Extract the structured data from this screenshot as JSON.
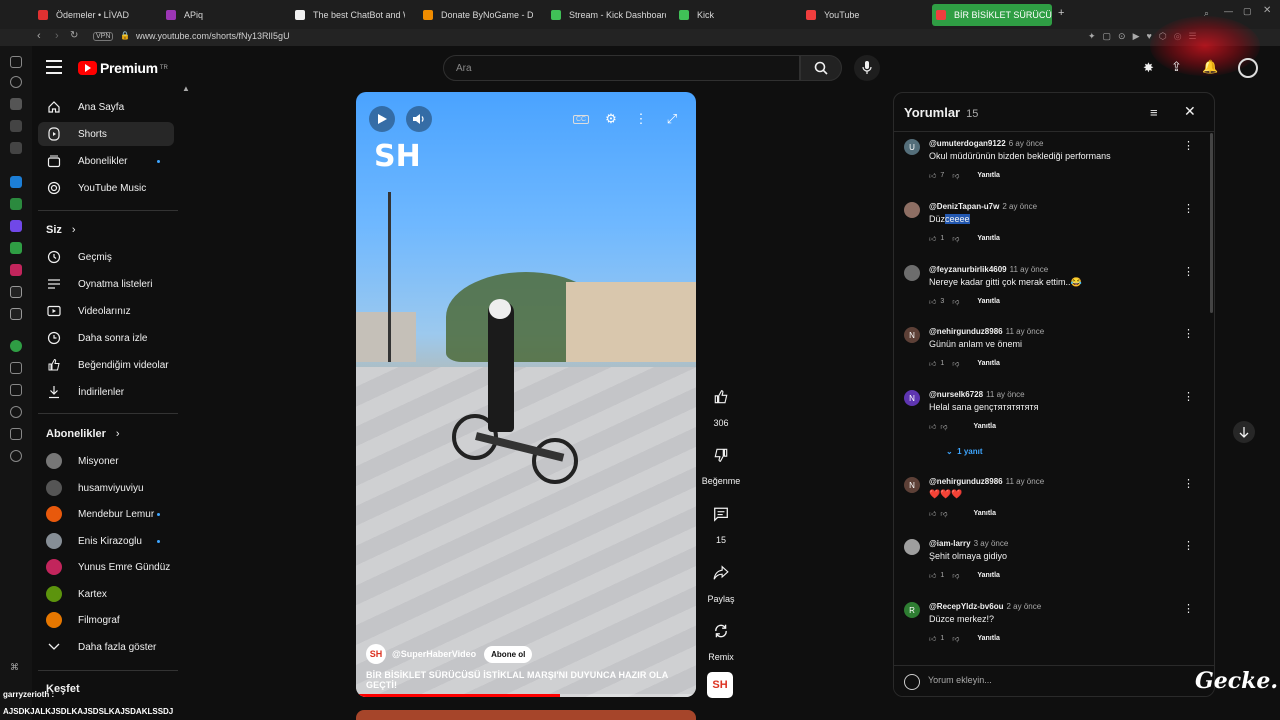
{
  "browser": {
    "tabs": [
      {
        "label": "Ödemeler • LİVAD",
        "color": "#e03131"
      },
      {
        "label": "APiq",
        "color": "#9c36b5"
      },
      {
        "label": "The best ChatBot and W",
        "color": "#f1f1f1"
      },
      {
        "label": "Donate ByNoGame - Don",
        "color": "#f08c00"
      },
      {
        "label": "Stream - Kick Dashboard",
        "color": "#40c057"
      },
      {
        "label": "Kick",
        "color": "#40c057"
      },
      {
        "label": "YouTube",
        "color": "#f03e3e"
      },
      {
        "label": "BİR BİSİKLET SÜRÜCÜSÜ",
        "color": "#f03e3e"
      }
    ],
    "vpn_label": "VPN",
    "url": "www.youtube.com/shorts/fNy13RlI5gU"
  },
  "header": {
    "logo_text": "Premium",
    "logo_sup": "TR",
    "search_placeholder": "Ara"
  },
  "sidebar": {
    "main": [
      {
        "label": "Ana Sayfa",
        "icon": "home-icon"
      },
      {
        "label": "Shorts",
        "icon": "shorts-icon"
      },
      {
        "label": "Abonelikler",
        "icon": "subscriptions-icon"
      },
      {
        "label": "YouTube Music",
        "icon": "music-icon"
      }
    ],
    "you_title": "Siz",
    "you": [
      {
        "label": "Geçmiş",
        "icon": "history-icon"
      },
      {
        "label": "Oynatma listeleri",
        "icon": "playlist-icon"
      },
      {
        "label": "Videolarınız",
        "icon": "your-videos-icon"
      },
      {
        "label": "Daha sonra izle",
        "icon": "watch-later-icon"
      },
      {
        "label": "Beğendiğim videolar",
        "icon": "liked-icon"
      },
      {
        "label": "İndirilenler",
        "icon": "download-icon"
      }
    ],
    "subs_title": "Abonelikler",
    "subs": [
      {
        "label": "Misyoner",
        "color": "#777777",
        "dot": false
      },
      {
        "label": "husamviyuviyu",
        "color": "#555555",
        "dot": false
      },
      {
        "label": "Mendebur Lemur",
        "color": "#e8590c",
        "dot": true
      },
      {
        "label": "Enis Kirazoglu",
        "color": "#868e96",
        "dot": true
      },
      {
        "label": "Yunus Emre Gündüz",
        "color": "#c2255c",
        "dot": false
      },
      {
        "label": "Kartex",
        "color": "#5c940d",
        "dot": false
      },
      {
        "label": "Filmograf",
        "color": "#e67700",
        "dot": false
      }
    ],
    "more_label": "Daha fazla göster",
    "explore_title": "Keşfet"
  },
  "video": {
    "logo_text": "SH",
    "channel_avatar": "SH",
    "channel": "@SuperHaberVideo",
    "subscribe_label": "Abone ol",
    "title": "BİR BİSİKLET SÜRÜCÜSÜ İSTİKLAL MARŞI'NI DUYUNCA HAZIR OLA GEÇTİ!",
    "progress": 0.6
  },
  "actions": {
    "likes": "306",
    "dislike_label": "Beğenme",
    "comments": "15",
    "share_label": "Paylaş",
    "remix_label": "Remix",
    "channel_badge": "SH"
  },
  "comments": {
    "title": "Yorumlar",
    "count": "15",
    "items": [
      {
        "user": "@umuterdogan9122",
        "time": "6 ay önce",
        "text": "Okul müdürünün bizden beklediği performans",
        "likes": "7",
        "avatar": "U",
        "color": "#546e7a"
      },
      {
        "user": "@DenizTapan-u7w",
        "time": "2 ay önce",
        "text_pre": "Düz",
        "text_hl": "ceeee",
        "likes": "1",
        "avatar": "",
        "color": "#8d6e63"
      },
      {
        "user": "@feyzanurbirlik4609",
        "time": "11 ay önce",
        "text": "Nereye kadar gitti çok merak ettim..😂",
        "likes": "3",
        "avatar": "",
        "color": "#6d6d6d"
      },
      {
        "user": "@nehirgunduz8986",
        "time": "11 ay önce",
        "text": "Günün anlam ve önemi",
        "likes": "1",
        "avatar": "N",
        "color": "#5d4037"
      },
      {
        "user": "@nurselk6728",
        "time": "11 ay önce",
        "text": "Helal sana gençтятятятятя",
        "likes": "",
        "avatar": "N",
        "color": "#5e35b1"
      },
      {
        "user": "@nehirgunduz8986",
        "time": "11 ay önce",
        "text": "❤️❤️❤️",
        "likes": "",
        "avatar": "N",
        "color": "#5d4037"
      },
      {
        "user": "@iam-larry",
        "time": "3 ay önce",
        "text": "Şehit olmaya gidiyo",
        "likes": "1",
        "avatar": "",
        "color": "#9e9e9e"
      },
      {
        "user": "@RecepYldz-bv6ou",
        "time": "2 ay önce",
        "text": "Düzce merkez!?",
        "likes": "1",
        "avatar": "R",
        "color": "#2e7d32"
      }
    ],
    "reply_label": "Yanıtla",
    "replies_link": "1 yanıt",
    "input_placeholder": "Yorum ekleyin..."
  },
  "overlay": {
    "streamer": "garryzerioth :",
    "chat_line": "AJSDKJALKJSDLKAJSDSLKAJSDAKLSSDJ",
    "watermark": "Gecke."
  }
}
